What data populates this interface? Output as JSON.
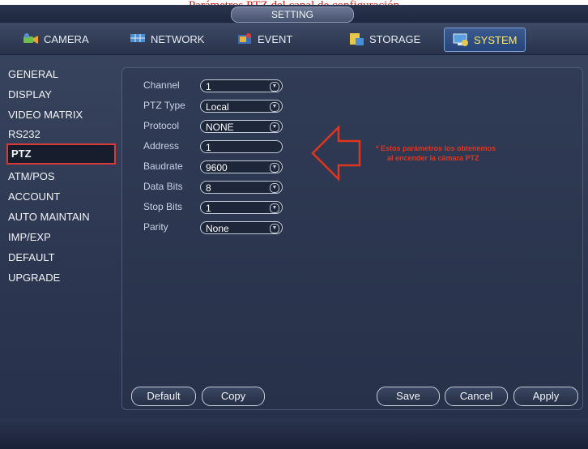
{
  "overlay": {
    "caption": "Parámetros PTZ del canal de configuración"
  },
  "window": {
    "title": "SETTING"
  },
  "tabs": [
    {
      "label": "CAMERA",
      "icon": "camera-icon"
    },
    {
      "label": "NETWORK",
      "icon": "network-icon"
    },
    {
      "label": "EVENT",
      "icon": "event-icon"
    },
    {
      "label": "STORAGE",
      "icon": "storage-icon"
    },
    {
      "label": "SYSTEM",
      "icon": "system-icon",
      "active": true
    }
  ],
  "sidebar": {
    "items": [
      {
        "label": "GENERAL"
      },
      {
        "label": "DISPLAY"
      },
      {
        "label": "VIDEO MATRIX"
      },
      {
        "label": "RS232"
      },
      {
        "label": "PTZ",
        "active": true
      },
      {
        "label": "ATM/POS"
      },
      {
        "label": "ACCOUNT"
      },
      {
        "label": "AUTO MAINTAIN"
      },
      {
        "label": "IMP/EXP"
      },
      {
        "label": "DEFAULT"
      },
      {
        "label": "UPGRADE"
      }
    ]
  },
  "form": {
    "channel": {
      "label": "Channel",
      "value": "1"
    },
    "ptz_type": {
      "label": "PTZ Type",
      "value": "Local"
    },
    "protocol": {
      "label": "Protocol",
      "value": "NONE"
    },
    "address": {
      "label": "Address",
      "value": "1"
    },
    "baudrate": {
      "label": "Baudrate",
      "value": "9600"
    },
    "data_bits": {
      "label": "Data Bits",
      "value": "8"
    },
    "stop_bits": {
      "label": "Stop Bits",
      "value": "1"
    },
    "parity": {
      "label": "Parity",
      "value": "None"
    }
  },
  "annotation": {
    "line1": "* Estos parámetros los obtenemos",
    "line2": "al encender la cámara PTZ",
    "color": "#e0351f"
  },
  "buttons": {
    "default": "Default",
    "copy": "Copy",
    "save": "Save",
    "cancel": "Cancel",
    "apply": "Apply"
  },
  "colors": {
    "highlight": "#d63a3a",
    "accent": "#7fa2d8"
  }
}
